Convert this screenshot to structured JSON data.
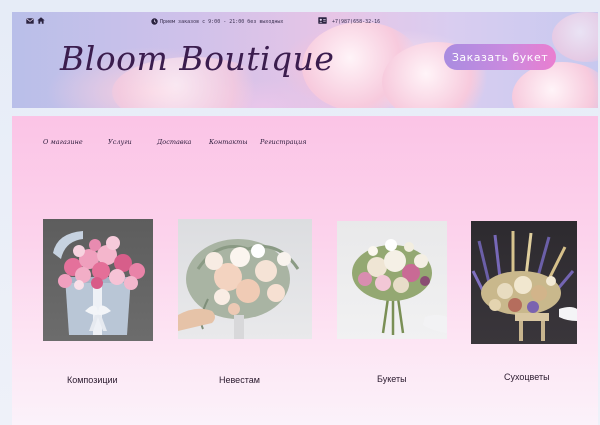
{
  "topbar": {
    "hours": "Прием заказов с 9:00 - 21:00 без выходных",
    "phone": "+7(987)658-32-16",
    "icons": [
      "mail-icon",
      "home-icon",
      "clock-icon",
      "contact-card-icon"
    ]
  },
  "hero": {
    "brand": "Bloom Boutique",
    "order_label": "Заказать букет"
  },
  "nav": {
    "items": [
      "О магазине",
      "Услуги",
      "Доставка",
      "Контакты",
      "Регистрация"
    ]
  },
  "categories": [
    {
      "label": "Композиции"
    },
    {
      "label": "Невестам"
    },
    {
      "label": "Букеты"
    },
    {
      "label": "Сухоцветы"
    }
  ],
  "colors": {
    "accent": "#c98adf",
    "brand_text": "#3b1d4e",
    "panel_top": "#fbc4e6"
  }
}
